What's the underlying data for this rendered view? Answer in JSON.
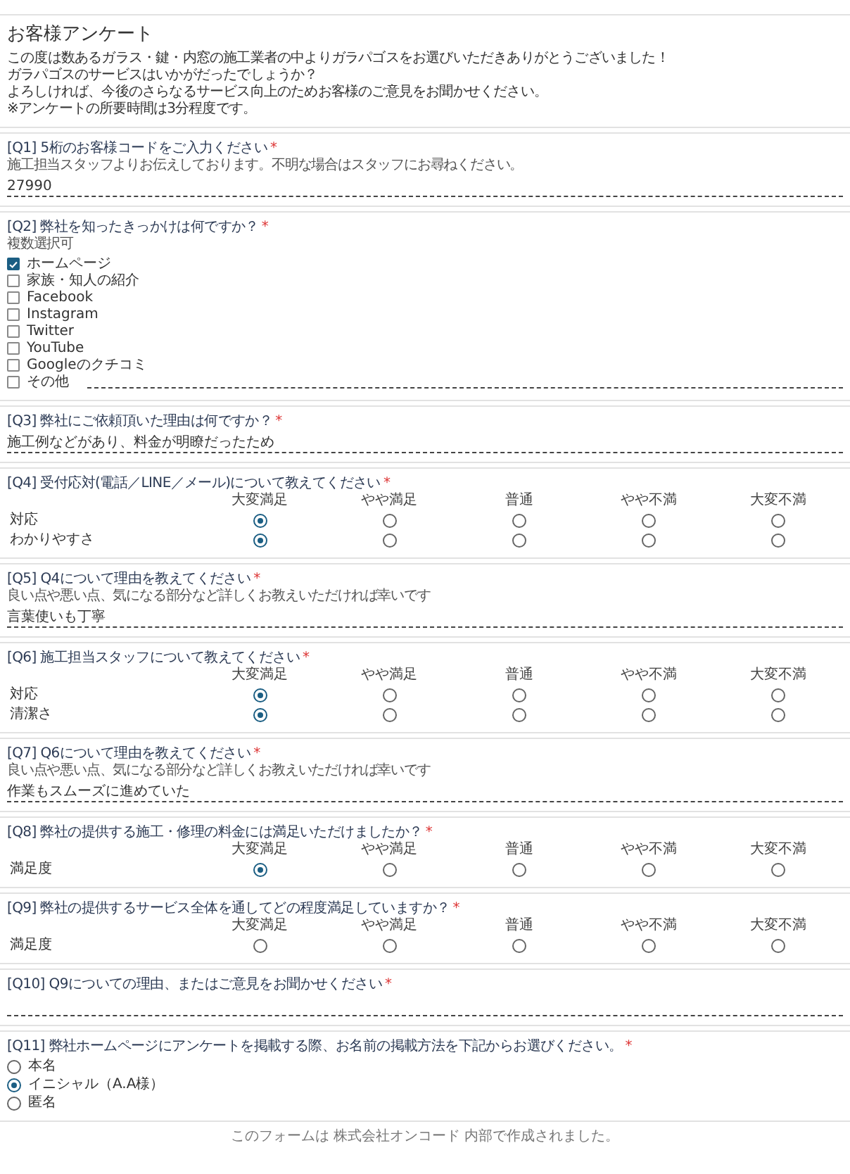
{
  "form": {
    "title": "お客様アンケート",
    "intro": [
      "この度は数あるガラス・鍵・内窓の施工業者の中よりガラパゴスをお選びいただきありがとうございました！",
      "ガラパゴスのサービスはいかがだったでしょうか？",
      "よろしければ、今後のさらなるサービス向上のためお客様のご意見をお聞かせください。",
      "※アンケートの所要時間は3分程度です。"
    ]
  },
  "questions": [
    {
      "kind": "text",
      "label": "[Q1] 5桁のお客様コードをご入力ください",
      "required_mark": "*",
      "help": "施工担当スタッフよりお伝えしております。不明な場合はスタッフにお尋ねください。",
      "value": "27990"
    },
    {
      "kind": "checkbox",
      "label": "[Q2] 弊社を知ったきっかけは何ですか？",
      "required_mark": "*",
      "help": "複数選択可",
      "options": [
        {
          "label": "ホームページ",
          "checked": true
        },
        {
          "label": "家族・知人の紹介",
          "checked": false
        },
        {
          "label": "Facebook",
          "checked": false
        },
        {
          "label": "Instagram",
          "checked": false
        },
        {
          "label": "Twitter",
          "checked": false
        },
        {
          "label": "YouTube",
          "checked": false
        },
        {
          "label": "Googleのクチコミ",
          "checked": false
        },
        {
          "label": "その他",
          "checked": false,
          "other": true
        }
      ]
    },
    {
      "kind": "text",
      "label": "[Q3] 弊社にご依頼頂いた理由は何ですか？",
      "required_mark": "*",
      "value": "施工例などがあり、料金が明瞭だったため"
    },
    {
      "kind": "matrix",
      "label": "[Q4] 受付応対(電話／LINE／メール)について教えてください",
      "required_mark": "*",
      "columns": [
        "大変満足",
        "やや満足",
        "普通",
        "やや不満",
        "大変不満"
      ],
      "rows": [
        {
          "label": "対応",
          "options": [
            {
              "selected": true
            },
            {
              "selected": false
            },
            {
              "selected": false
            },
            {
              "selected": false
            },
            {
              "selected": false
            }
          ]
        },
        {
          "label": "わかりやすさ",
          "options": [
            {
              "selected": true
            },
            {
              "selected": false
            },
            {
              "selected": false
            },
            {
              "selected": false
            },
            {
              "selected": false
            }
          ]
        }
      ]
    },
    {
      "kind": "text",
      "label": "[Q5] Q4について理由を教えてください",
      "required_mark": "*",
      "help": "良い点や悪い点、気になる部分など詳しくお教えいただければ幸いです",
      "value": "言葉使いも丁寧"
    },
    {
      "kind": "matrix",
      "label": "[Q6] 施工担当スタッフについて教えてください",
      "required_mark": "*",
      "columns": [
        "大変満足",
        "やや満足",
        "普通",
        "やや不満",
        "大変不満"
      ],
      "rows": [
        {
          "label": "対応",
          "options": [
            {
              "selected": true
            },
            {
              "selected": false
            },
            {
              "selected": false
            },
            {
              "selected": false
            },
            {
              "selected": false
            }
          ]
        },
        {
          "label": "清潔さ",
          "options": [
            {
              "selected": true
            },
            {
              "selected": false
            },
            {
              "selected": false
            },
            {
              "selected": false
            },
            {
              "selected": false
            }
          ]
        }
      ]
    },
    {
      "kind": "text",
      "label": "[Q7] Q6について理由を教えてください",
      "required_mark": "*",
      "help": "良い点や悪い点、気になる部分など詳しくお教えいただければ幸いです",
      "value": "作業もスムーズに進めていた"
    },
    {
      "kind": "matrix",
      "label": "[Q8] 弊社の提供する施工・修理の料金には満足いただけましたか？",
      "required_mark": "*",
      "columns": [
        "大変満足",
        "やや満足",
        "普通",
        "やや不満",
        "大変不満"
      ],
      "rows": [
        {
          "label": "満足度",
          "options": [
            {
              "selected": true
            },
            {
              "selected": false
            },
            {
              "selected": false
            },
            {
              "selected": false
            },
            {
              "selected": false
            }
          ]
        }
      ]
    },
    {
      "kind": "matrix",
      "label": "[Q9] 弊社の提供するサービス全体を通してどの程度満足していますか？",
      "required_mark": "*",
      "columns": [
        "大変満足",
        "やや満足",
        "普通",
        "やや不満",
        "大変不満"
      ],
      "rows": [
        {
          "label": "満足度",
          "options": [
            {
              "selected": false
            },
            {
              "selected": false
            },
            {
              "selected": false
            },
            {
              "selected": false
            },
            {
              "selected": false
            }
          ]
        }
      ]
    },
    {
      "kind": "text",
      "label": "[Q10] Q9についての理由、またはご意見をお聞かせください",
      "required_mark": "*"
    },
    {
      "kind": "radio",
      "label": "[Q11] 弊社ホームページにアンケートを掲載する際、お名前の掲載方法を下記からお選びください。",
      "required_mark": "*",
      "options": [
        {
          "label": "本名",
          "selected": false
        },
        {
          "label": "イニシャル（A.A様）",
          "selected": true
        },
        {
          "label": "匿名",
          "selected": false
        }
      ]
    }
  ],
  "footer": "このフォームは 株式会社オンコード 内部で作成されました。"
}
